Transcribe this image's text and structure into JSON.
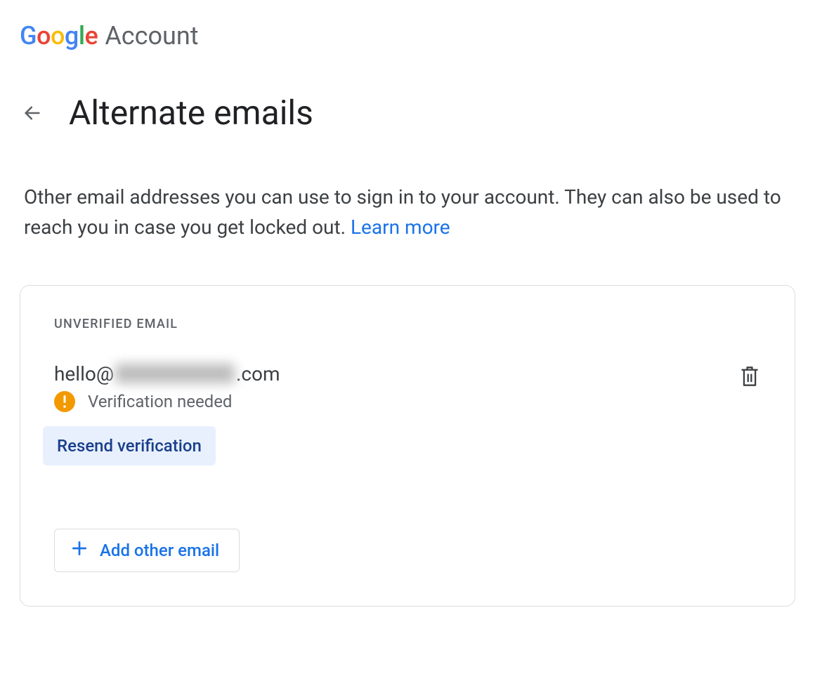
{
  "branding": {
    "logo": {
      "letters": [
        "G",
        "o",
        "o",
        "g",
        "l",
        "e"
      ]
    },
    "product": "Account"
  },
  "page": {
    "title": "Alternate emails",
    "description_part1": "Other email addresses you can use to sign in to your account. They can also be used to reach you in case you get locked out. ",
    "learn_more": "Learn more"
  },
  "card": {
    "section_label": "UNVERIFIED EMAIL",
    "email_prefix": "hello@",
    "email_suffix": ".com",
    "status_text": "Verification needed",
    "resend_label": "Resend verification",
    "add_label": "Add other email"
  }
}
